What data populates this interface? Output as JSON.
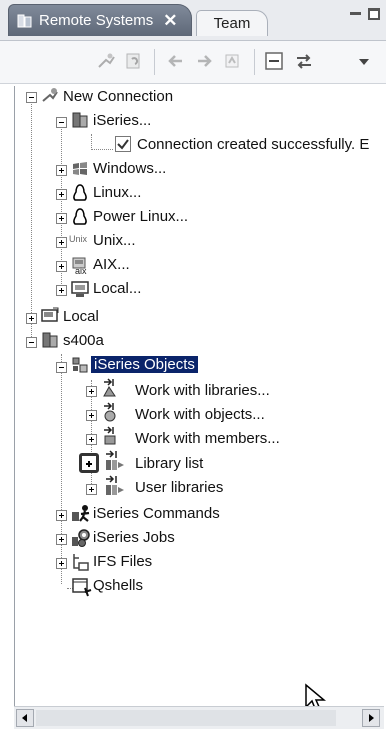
{
  "view": {
    "tab_active_label": "Remote Systems",
    "tab_close": "✕",
    "tab_inactive_label": "Team"
  },
  "colors": {
    "tab_active_bg": "#6c7687",
    "selection_bg": "#0a246a",
    "tree_line": "#888888"
  },
  "toolbar": {
    "icons": [
      "new-connection-icon",
      "refresh-icon",
      "back-icon",
      "forward-icon",
      "home-icon",
      "collapse-all-icon",
      "link-with-editor-icon",
      "view-menu-icon"
    ]
  },
  "tree": {
    "new_connection": "New Connection",
    "iseries": "iSeries...",
    "connection_msg": "Connection created successfully. E",
    "windows": "Windows...",
    "linux": "Linux...",
    "power_linux": "Power Linux...",
    "unix": "Unix...",
    "aix": "AIX...",
    "local_dots": "Local...",
    "local": "Local",
    "s400a": "s400a",
    "iseries_objects": "iSeries Objects",
    "work_libraries": "Work with libraries...",
    "work_objects": "Work with objects...",
    "work_members": "Work with members...",
    "library_list": "Library list",
    "user_libraries": "User libraries",
    "iseries_commands": "iSeries Commands",
    "iseries_jobs": "iSeries Jobs",
    "ifs_files": "IFS Files",
    "qshells": "Qshells",
    "unix_icon_text": "Unix",
    "aix_icon_text": "aix"
  }
}
